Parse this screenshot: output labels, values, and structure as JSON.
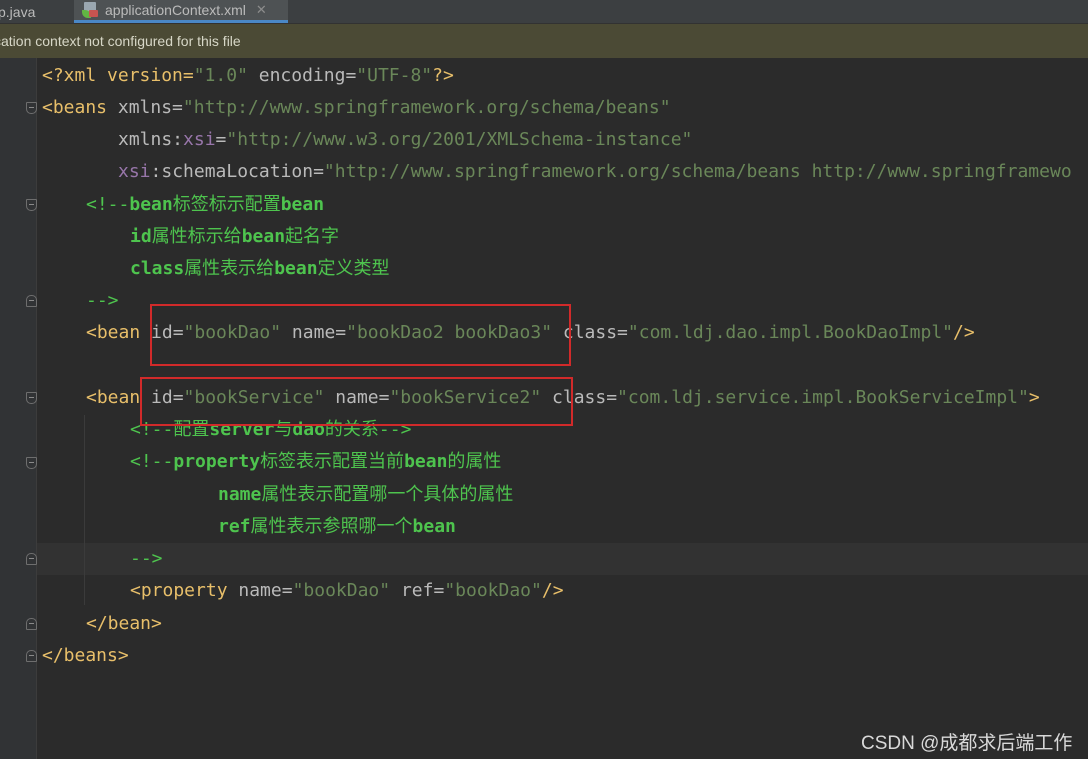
{
  "tabs": [
    {
      "label": "p.java",
      "active": false
    },
    {
      "label": "applicationContext.xml",
      "active": true,
      "close": "✕"
    }
  ],
  "notification": "cation context not configured for this file",
  "code": {
    "l1": {
      "a": "<?xml version=",
      "b": "\"1.0\"",
      "c": " encoding=",
      "d": "\"UTF-8\"",
      "e": "?>"
    },
    "l2": {
      "a": "<beans",
      "b": " xmlns=",
      "c": "\"http://www.springframework.org/schema/beans\""
    },
    "l3": {
      "a": "xmlns:",
      "b": "xsi",
      "c": "=",
      "d": "\"http://www.w3.org/2001/XMLSchema-instance\""
    },
    "l4": {
      "a": "xsi",
      "b": ":schemaLocation=",
      "c": "\"http://www.springframework.org/schema/beans http://www.springframewo"
    },
    "l5": {
      "a": "<!--",
      "b": "bean",
      "c": "标签标示配置",
      "d": "bean"
    },
    "l6": {
      "a": "id",
      "b": "属性标示给",
      "c": "bean",
      "d": "起名字"
    },
    "l7": {
      "a": "class",
      "b": "属性表示给",
      "c": "bean",
      "d": "定义类型"
    },
    "l8": {
      "a": "-->"
    },
    "l9": {
      "a": "<bean",
      "b": " id=",
      "c": "\"bookDao\"",
      "d": " name=",
      "e": "\"bookDao2 bookDao3\"",
      "f": " class=",
      "g": "\"com.ldj.dao.impl.BookDaoImpl\"",
      "h": "/>"
    },
    "l10": {
      "a": "<bean",
      "b": " id=",
      "c": "\"bookService\"",
      "d": " name=",
      "e": "\"bookService2\"",
      "f": " class=",
      "g": "\"com.ldj.service.impl.BookServiceImpl\"",
      "h": ">"
    },
    "l11": {
      "a": "<!--",
      "b": "配置",
      "c": "server",
      "d": "与",
      "e": "dao",
      "f": "的关系",
      "g": "-->"
    },
    "l12": {
      "a": "<!--",
      "b": "property",
      "c": "标签表示配置当前",
      "d": "bean",
      "e": "的属性"
    },
    "l13": {
      "a": "name",
      "b": "属性表示配置哪一个具体的属性"
    },
    "l14": {
      "a": "ref",
      "b": "属性表示参照哪一个",
      "c": "bean"
    },
    "l15": {
      "a": "-->"
    },
    "l16": {
      "a": "<property",
      "b": " name=",
      "c": "\"bookDao\"",
      "d": " ref=",
      "e": "\"bookDao\"",
      "f": "/>"
    },
    "l17": {
      "a": "</bean>"
    },
    "l18": {
      "a": "</beans>"
    }
  },
  "watermark": "CSDN @成都求后端工作",
  "colors": {
    "background": "#2b2b2b",
    "tag": "#e8bf6a",
    "string": "#6a8759",
    "namespace": "#9876aa",
    "comment": "#4ec44e",
    "highlight_box": "#d12a2a",
    "notification_bg": "#4b4a35"
  }
}
